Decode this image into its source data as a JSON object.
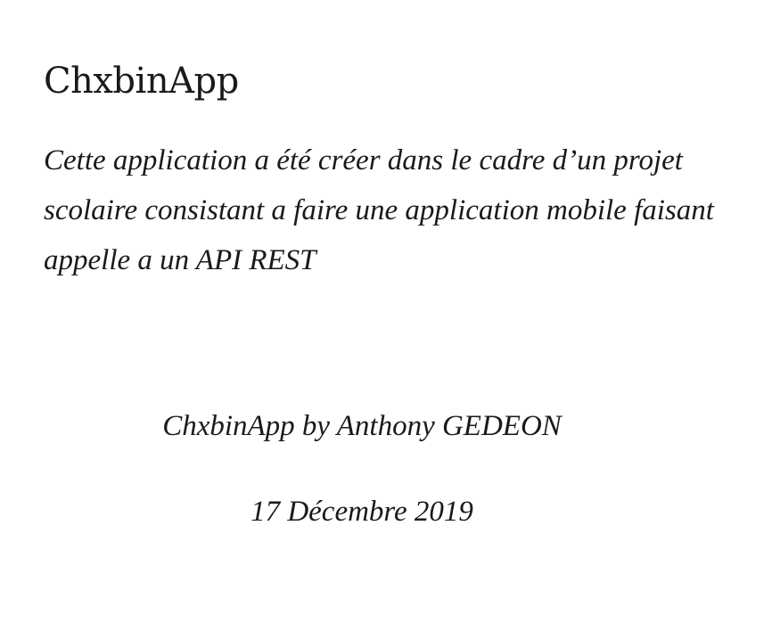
{
  "document": {
    "title": "ChxbinApp",
    "description": "Cette application a été créer dans le cadre d’un projet scolaire consistant a faire une application mobile faisant appelle a un API REST",
    "author_line": "ChxbinApp by Anthony GEDEON",
    "date": "17 Décembre 2019"
  }
}
